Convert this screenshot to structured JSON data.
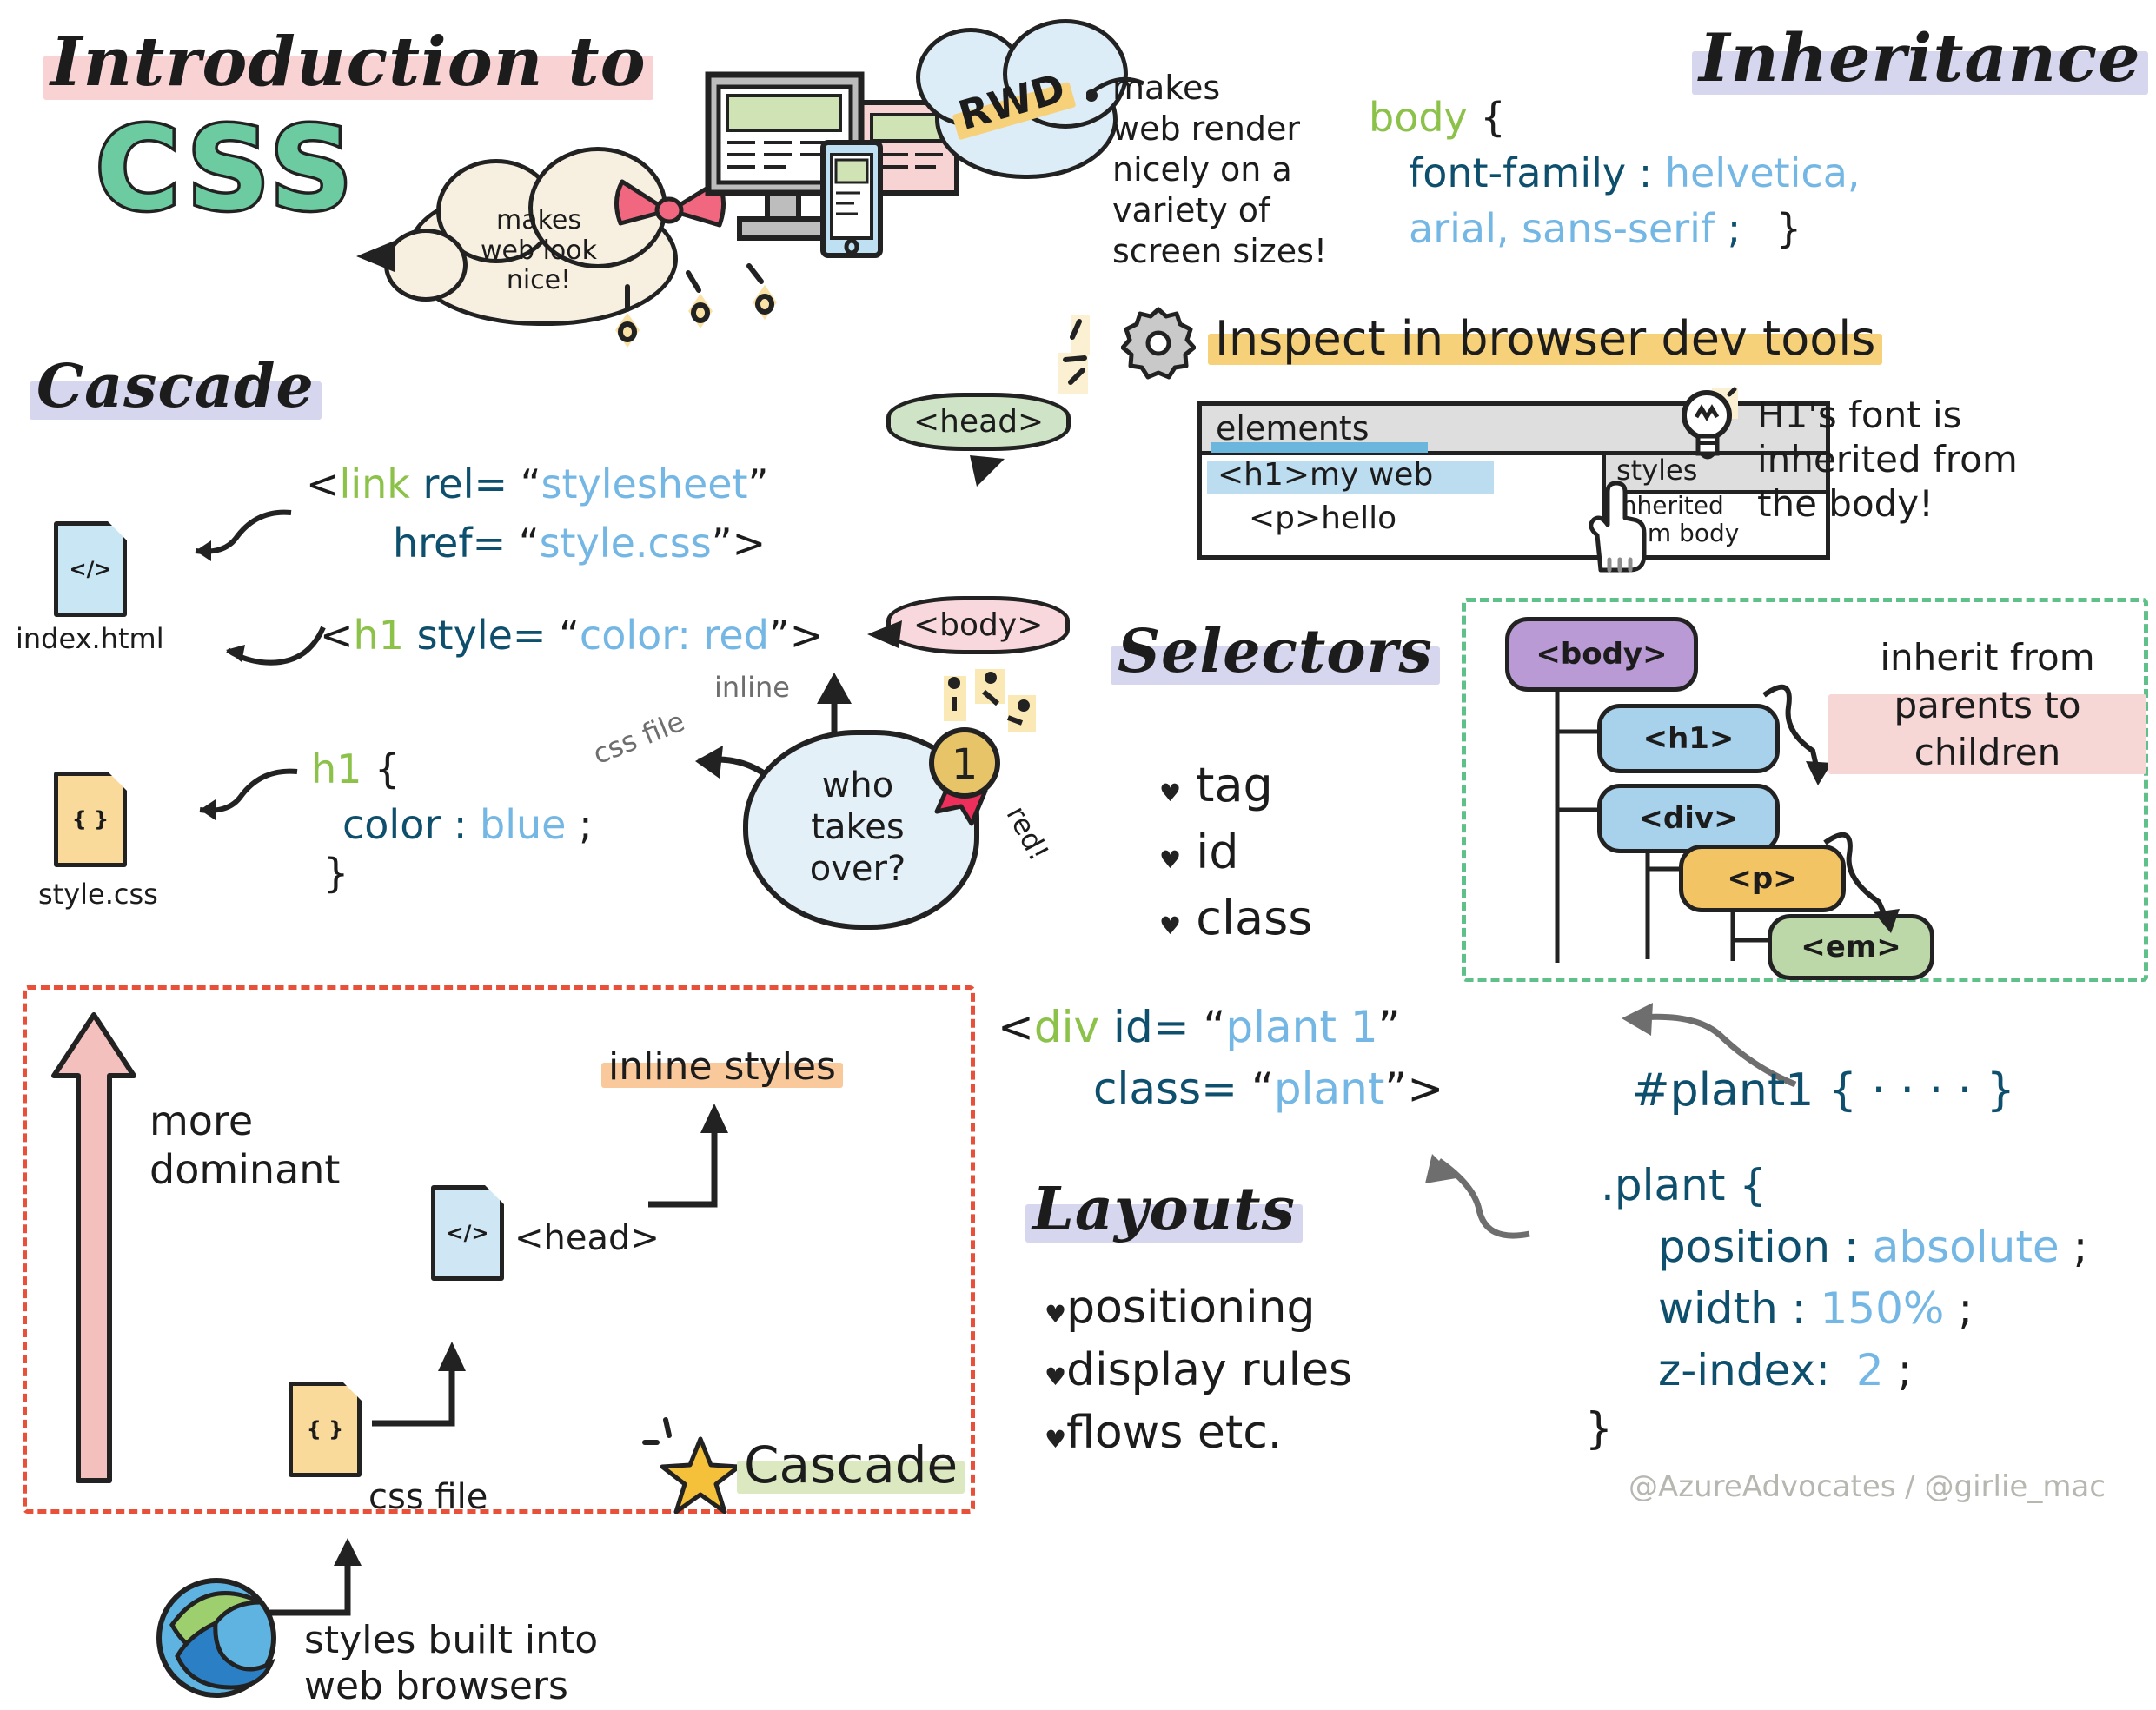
{
  "title": {
    "line1": "Introduction to",
    "line2": "CSS"
  },
  "bubbles": {
    "makes_web_look_nice": "makes\nweb look\nnice!",
    "rwd_label": "RWD",
    "rwd_note": "makes\nweb render\nnicely on a\nvariety of\nscreen sizes!"
  },
  "inheritance": {
    "heading": "Inheritance",
    "code": {
      "selector": "body",
      "open_brace": "{",
      "property": "font-family",
      "colon": ":",
      "value_line1": "helvetica,",
      "value_line2": "arial, sans-serif",
      "semicolon": ";",
      "close_brace": "}"
    },
    "tip": "H1's font is\ninherited from\nthe body!",
    "tree_note": "inherit from\nparents to\nchildren",
    "tree": [
      {
        "label": "<body>",
        "color": "#b99ad4",
        "depth": 0
      },
      {
        "label": "<h1>",
        "color": "#a8d2ec",
        "depth": 1
      },
      {
        "label": "<div>",
        "color": "#a8d2ec",
        "depth": 1
      },
      {
        "label": "<p>",
        "color": "#f3c464",
        "depth": 2
      },
      {
        "label": "<em>",
        "color": "#bdd8a8",
        "depth": 3
      }
    ]
  },
  "devtools": {
    "heading": "Inspect in browser dev tools",
    "panel_tab": "elements",
    "elements": [
      "<h1>my web",
      "<p>hello"
    ],
    "styles_tab": "styles",
    "styles_note": "inherited\nfrom body"
  },
  "cascade": {
    "heading": "Cascade",
    "html_file_label": "index.html",
    "html_file_glyph": "</>",
    "css_file_label": "style.css",
    "css_file_glyph": "{ }",
    "head_tag": "<head>",
    "body_tag": "<body>",
    "link_line1": {
      "lt": "<",
      "tag": "link",
      "attr": "rel",
      "eq": "=",
      "q1": "“",
      "value": "stylesheet",
      "q2": "”"
    },
    "link_line2": {
      "attr": "href",
      "eq": "=",
      "q1": "“",
      "value": "style.css",
      "q2": "”",
      "gt": ">"
    },
    "h1_line": {
      "lt": "<",
      "tag": "h1",
      "attr": "style",
      "eq": "=",
      "q1": "“",
      "value": "color: red",
      "q2": "”",
      "gt": ">"
    },
    "inline_label": "inline",
    "cssfile_label": "css file",
    "css_rule": {
      "selector": "h1",
      "open_brace": "{",
      "property": "color",
      "colon": ":",
      "value": "blue",
      "semicolon": ";",
      "close_brace": "}"
    },
    "question": "who\ntakes\nover?",
    "medal_number": "1",
    "medal_answer": "red!"
  },
  "selectors": {
    "heading": "Selectors",
    "items": [
      "tag",
      "id",
      "class"
    ]
  },
  "plant": {
    "div_line1": {
      "lt": "<",
      "tag": "div",
      "attr": "id",
      "eq": "=",
      "q1": "“",
      "value": "plant 1",
      "q2": "”"
    },
    "div_line2": {
      "attr": "class",
      "eq": "=",
      "q1": "“",
      "value": "plant",
      "q2": "”",
      "gt": ">"
    },
    "id_rule": "#plant1 { · · · · }",
    "class_rule": {
      "selector": ".plant",
      "open_brace": "{",
      "declarations": [
        {
          "property": "position",
          "colon": ":",
          "value": "absolute",
          "semicolon": ";"
        },
        {
          "property": "width",
          "colon": ":",
          "value": "150%",
          "semicolon": ";"
        },
        {
          "property": "z-index:",
          "colon": "",
          "value": "2",
          "semicolon": ";"
        }
      ],
      "close_brace": "}"
    }
  },
  "layouts": {
    "heading": "Layouts",
    "items": [
      "positioning",
      "display rules",
      "flows     etc."
    ]
  },
  "dominance": {
    "arrow_label": "more\ndominant",
    "inline_styles": "inline styles",
    "head_label": "<head>",
    "head_file_glyph": "</>",
    "css_file_label": "css file",
    "css_file_glyph": "{ }",
    "browser_note": "styles built into\nweb browsers",
    "cascade_label": "Cascade"
  },
  "credit": "@AzureAdvocates / @girlie_mac",
  "colors": {
    "green": "#8cc24a",
    "navy": "#0d4f6c",
    "blue": "#74b7e4",
    "mint": "#6dcba2",
    "red": "#e8503a",
    "highlight_pink": "#f9d2d4",
    "highlight_purple": "#d7d6ef",
    "highlight_yellow": "#f6d17a"
  }
}
